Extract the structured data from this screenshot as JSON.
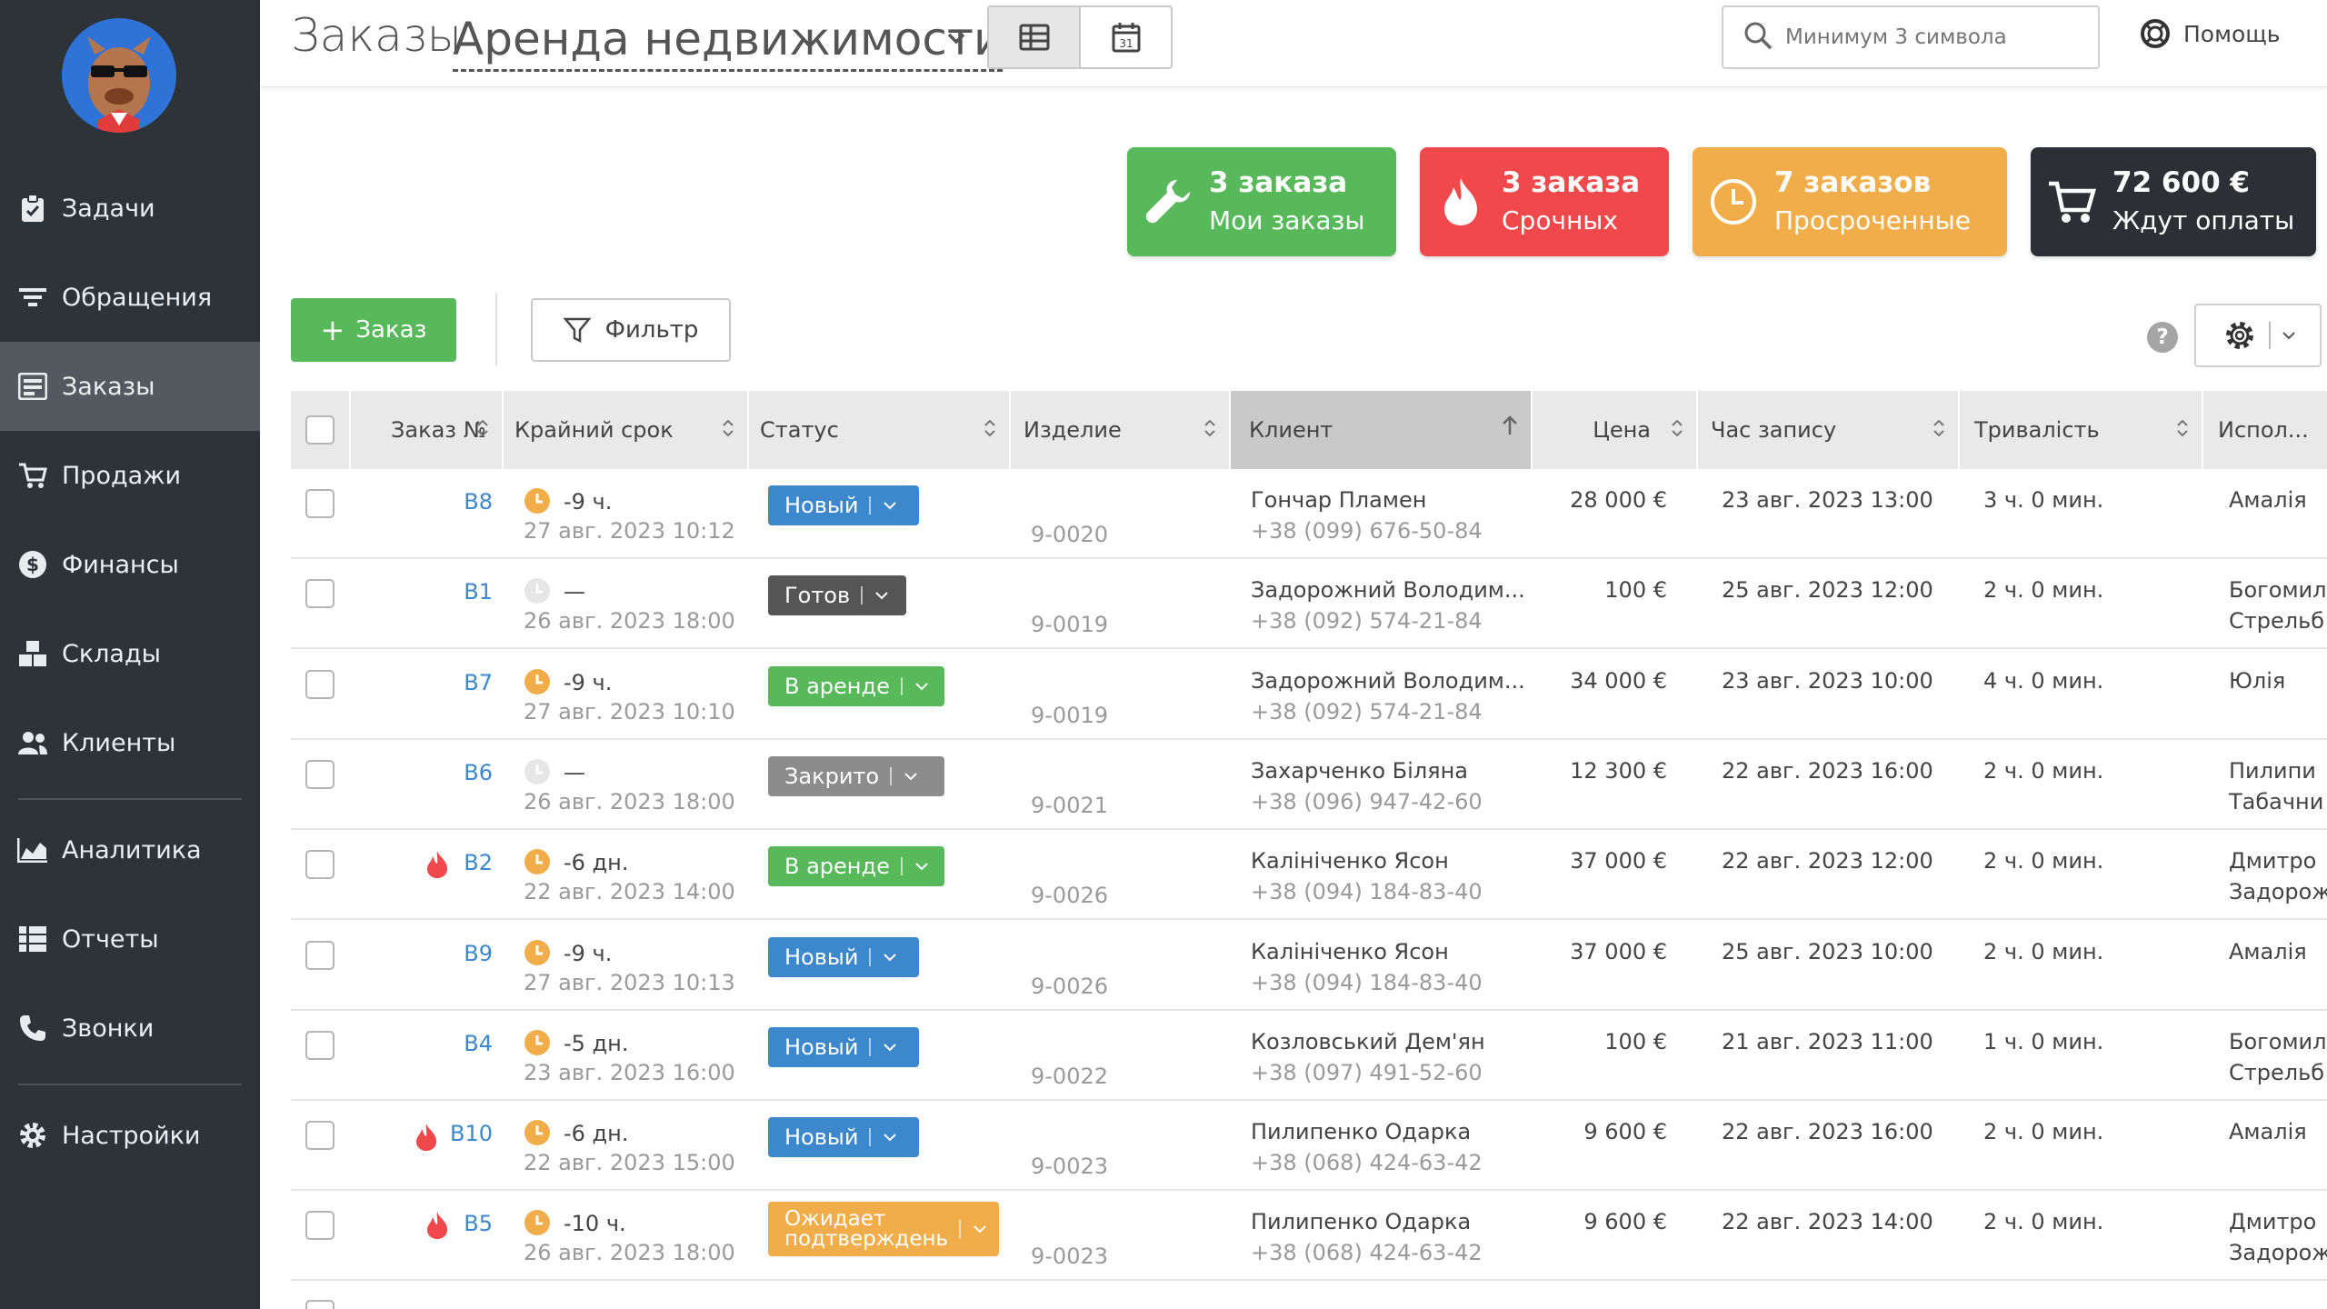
{
  "colors": {
    "sidebar_bg": "#2e3338",
    "sidebar_active": "#54595f",
    "card_green": "#58b95b",
    "card_red": "#f0484b",
    "card_orange": "#f2ad4b",
    "card_dark": "#2c2f33",
    "status_new": "#3d87cd",
    "status_ready": "#555555",
    "status_rent": "#58b95b",
    "status_closed": "#8c8c8c",
    "status_pending": "#f2ad4b",
    "link": "#3d87cd"
  },
  "sidebar": {
    "items": [
      {
        "label": "Задачи",
        "icon": "clipboard-icon"
      },
      {
        "label": "Обращения",
        "icon": "filter-lines-icon"
      },
      {
        "label": "Заказы",
        "icon": "orders-icon",
        "active": true
      },
      {
        "label": "Продажи",
        "icon": "cart-icon"
      },
      {
        "label": "Финансы",
        "icon": "dollar-icon"
      },
      {
        "label": "Склады",
        "icon": "boxes-icon"
      },
      {
        "label": "Клиенты",
        "icon": "users-icon"
      },
      {
        "label": "Аналитика",
        "icon": "area-chart-icon"
      },
      {
        "label": "Отчеты",
        "icon": "table-icon"
      },
      {
        "label": "Звонки",
        "icon": "phone-icon"
      },
      {
        "label": "Настройки",
        "icon": "gear-icon"
      }
    ]
  },
  "header": {
    "title": "Заказы",
    "subtitle": "Аренда недвижимости",
    "search_placeholder": "Минимум 3 символа",
    "help": "Помощь"
  },
  "cards": [
    {
      "line1": "3 заказа",
      "line2": "Мои заказы",
      "icon": "wrench-icon"
    },
    {
      "line1": "3 заказа",
      "line2": "Срочных",
      "icon": "fire-icon"
    },
    {
      "line1": "7 заказов",
      "line2": "Просроченные",
      "icon": "clock-icon"
    },
    {
      "line1": "72 600 €",
      "line2": "Ждут оплаты",
      "icon": "cart-icon"
    }
  ],
  "toolbar": {
    "add_label": "Заказ",
    "filter_label": "Фильтр",
    "help_label": "?"
  },
  "table": {
    "columns": [
      "Заказ №",
      "Крайний срок",
      "Статус",
      "Изделие",
      "Клиент",
      "Цена",
      "Час запису",
      "Тривалість",
      "Испол..."
    ],
    "rows": [
      {
        "urgent": false,
        "id": "B8",
        "clock": "orange",
        "deadline": "-9 ч.",
        "deadline_date": "27 авг. 2023 10:12",
        "status": "Новый",
        "status_color": "#3d87cd",
        "item": "9-0020",
        "client": "Гончар Пламен",
        "phone": "+38 (099) 676-50-84",
        "price": "28 000 €",
        "time": "23 авг. 2023 13:00",
        "duration": "3 ч. 0 мин.",
        "exec1": "Амалія",
        "exec2": ""
      },
      {
        "urgent": false,
        "id": "B1",
        "clock": "grey",
        "deadline": "—",
        "deadline_date": "26 авг. 2023 18:00",
        "status": "Готов",
        "status_color": "#555555",
        "item": "9-0019",
        "client": "Задорожний Володим...",
        "phone": "+38 (092) 574-21-84",
        "price": "100 €",
        "time": "25 авг. 2023 12:00",
        "duration": "2 ч. 0 мин.",
        "exec1": "Богомил",
        "exec2": "Стрельб"
      },
      {
        "urgent": false,
        "id": "B7",
        "clock": "orange",
        "deadline": "-9 ч.",
        "deadline_date": "27 авг. 2023 10:10",
        "status": "В аренде",
        "status_color": "#58b95b",
        "item": "9-0019",
        "client": "Задорожний Володим...",
        "phone": "+38 (092) 574-21-84",
        "price": "34 000 €",
        "time": "23 авг. 2023 10:00",
        "duration": "4 ч. 0 мин.",
        "exec1": "Юлія",
        "exec2": ""
      },
      {
        "urgent": false,
        "id": "B6",
        "clock": "grey",
        "deadline": "—",
        "deadline_date": "26 авг. 2023 18:00",
        "status": "Закрито",
        "status_color": "#8c8c8c",
        "item": "9-0021",
        "client": "Захарченко Біляна",
        "phone": "+38 (096) 947-42-60",
        "price": "12 300 €",
        "time": "22 авг. 2023 16:00",
        "duration": "2 ч. 0 мин.",
        "exec1": "Пилипи",
        "exec2": "Табачни"
      },
      {
        "urgent": true,
        "id": "B2",
        "clock": "orange",
        "deadline": "-6 дн.",
        "deadline_date": "22 авг. 2023 14:00",
        "status": "В аренде",
        "status_color": "#58b95b",
        "item": "9-0026",
        "client": "Калініченко Ясон",
        "phone": "+38 (094) 184-83-40",
        "price": "37 000 €",
        "time": "22 авг. 2023 12:00",
        "duration": "2 ч. 0 мин.",
        "exec1": "Дмитро",
        "exec2": "Задорож"
      },
      {
        "urgent": false,
        "id": "B9",
        "clock": "orange",
        "deadline": "-9 ч.",
        "deadline_date": "27 авг. 2023 10:13",
        "status": "Новый",
        "status_color": "#3d87cd",
        "item": "9-0026",
        "client": "Калініченко Ясон",
        "phone": "+38 (094) 184-83-40",
        "price": "37 000 €",
        "time": "25 авг. 2023 10:00",
        "duration": "2 ч. 0 мин.",
        "exec1": "Амалія",
        "exec2": ""
      },
      {
        "urgent": false,
        "id": "B4",
        "clock": "orange",
        "deadline": "-5 дн.",
        "deadline_date": "23 авг. 2023 16:00",
        "status": "Новый",
        "status_color": "#3d87cd",
        "item": "9-0022",
        "client": "Козловський Дем'ян",
        "phone": "+38 (097) 491-52-60",
        "price": "100 €",
        "time": "21 авг. 2023 11:00",
        "duration": "1 ч. 0 мин.",
        "exec1": "Богомил",
        "exec2": "Стрельб"
      },
      {
        "urgent": true,
        "id": "B10",
        "clock": "orange",
        "deadline": "-6 дн.",
        "deadline_date": "22 авг. 2023 15:00",
        "status": "Новый",
        "status_color": "#3d87cd",
        "item": "9-0023",
        "client": "Пилипенко Одарка",
        "phone": "+38 (068) 424-63-42",
        "price": "9 600 €",
        "time": "22 авг. 2023 16:00",
        "duration": "2 ч. 0 мин.",
        "exec1": "Амалія",
        "exec2": ""
      },
      {
        "urgent": true,
        "id": "B5",
        "clock": "orange",
        "deadline": "-10 ч.",
        "deadline_date": "26 авг. 2023 18:00",
        "status": "Ожидает подтверждения",
        "status_line1": "Ожидает",
        "status_line2": "подтверждень",
        "status_color": "#f2ad4b",
        "item": "9-0023",
        "client": "Пилипенко Одарка",
        "phone": "+38 (068) 424-63-42",
        "price": "9 600 €",
        "time": "22 авг. 2023 14:00",
        "duration": "2 ч. 0 мин.",
        "exec1": "Дмитро",
        "exec2": "Задорож"
      }
    ]
  }
}
